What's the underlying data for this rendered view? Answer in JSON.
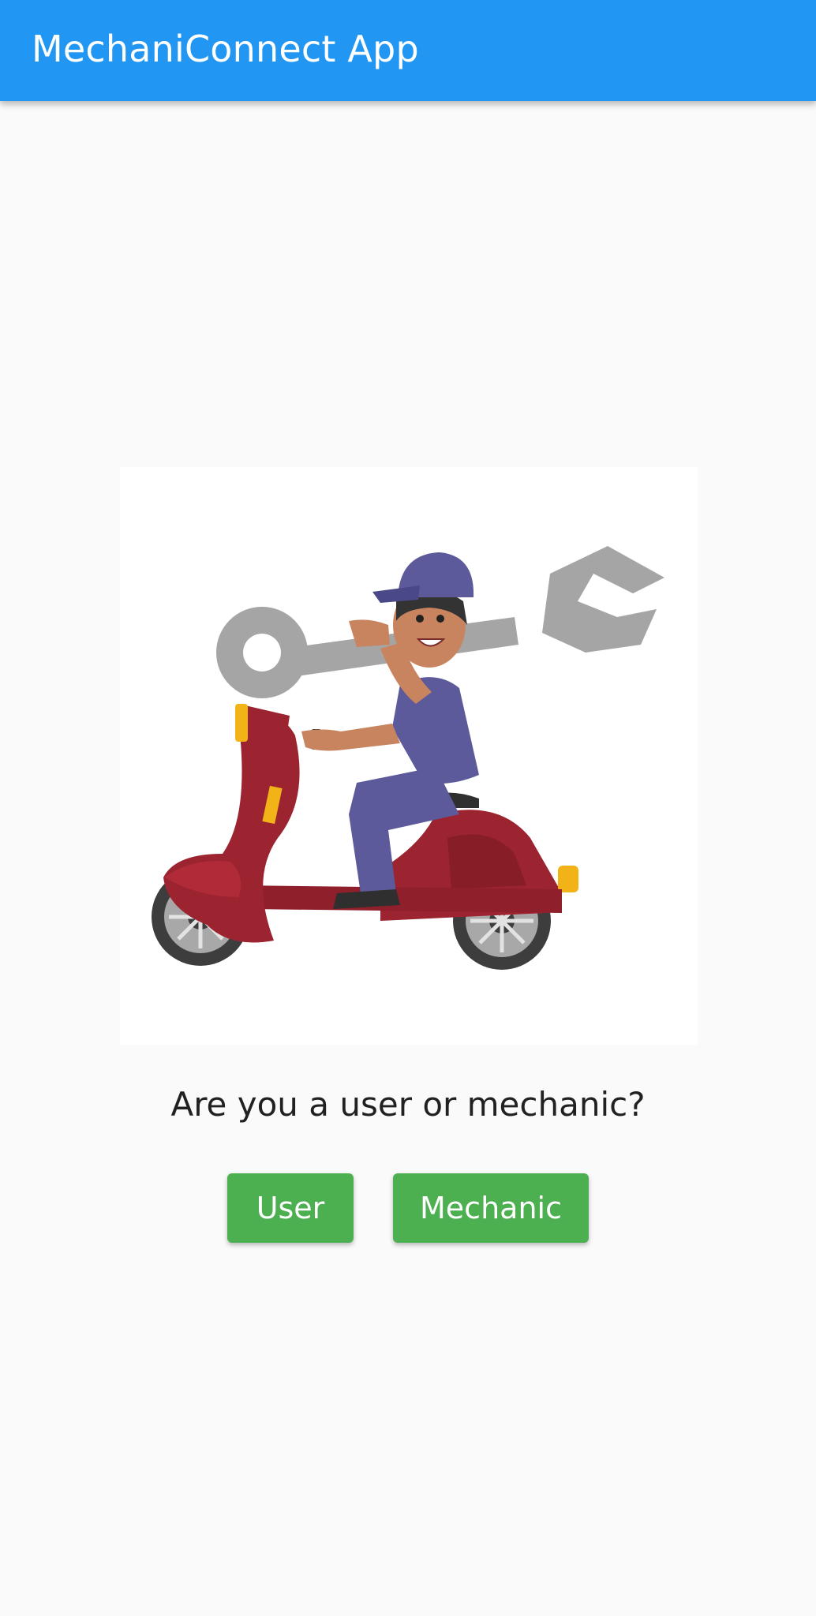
{
  "app_bar": {
    "title": "MechaniConnect App",
    "color": "#2196f3"
  },
  "illustration": {
    "subject": "mechanic riding scooter carrying wrench"
  },
  "main": {
    "question": "Are you a user or mechanic?",
    "buttons": [
      {
        "label": "User"
      },
      {
        "label": "Mechanic"
      }
    ],
    "button_color": "#4caf50"
  }
}
